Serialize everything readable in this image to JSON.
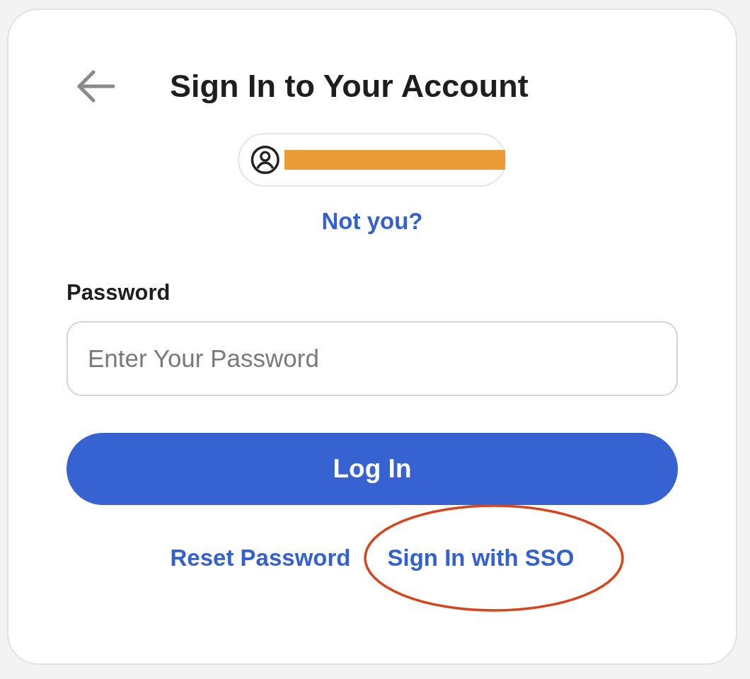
{
  "header": {
    "title": "Sign In to Your Account"
  },
  "account": {
    "redacted": true
  },
  "not_you_link": "Not you?",
  "password": {
    "label": "Password",
    "placeholder": "Enter Your Password"
  },
  "login_button": "Log In",
  "links": [
    {
      "label": "Reset Password",
      "circled": false
    },
    {
      "label": "Sign In with SSO",
      "circled": true
    }
  ]
}
